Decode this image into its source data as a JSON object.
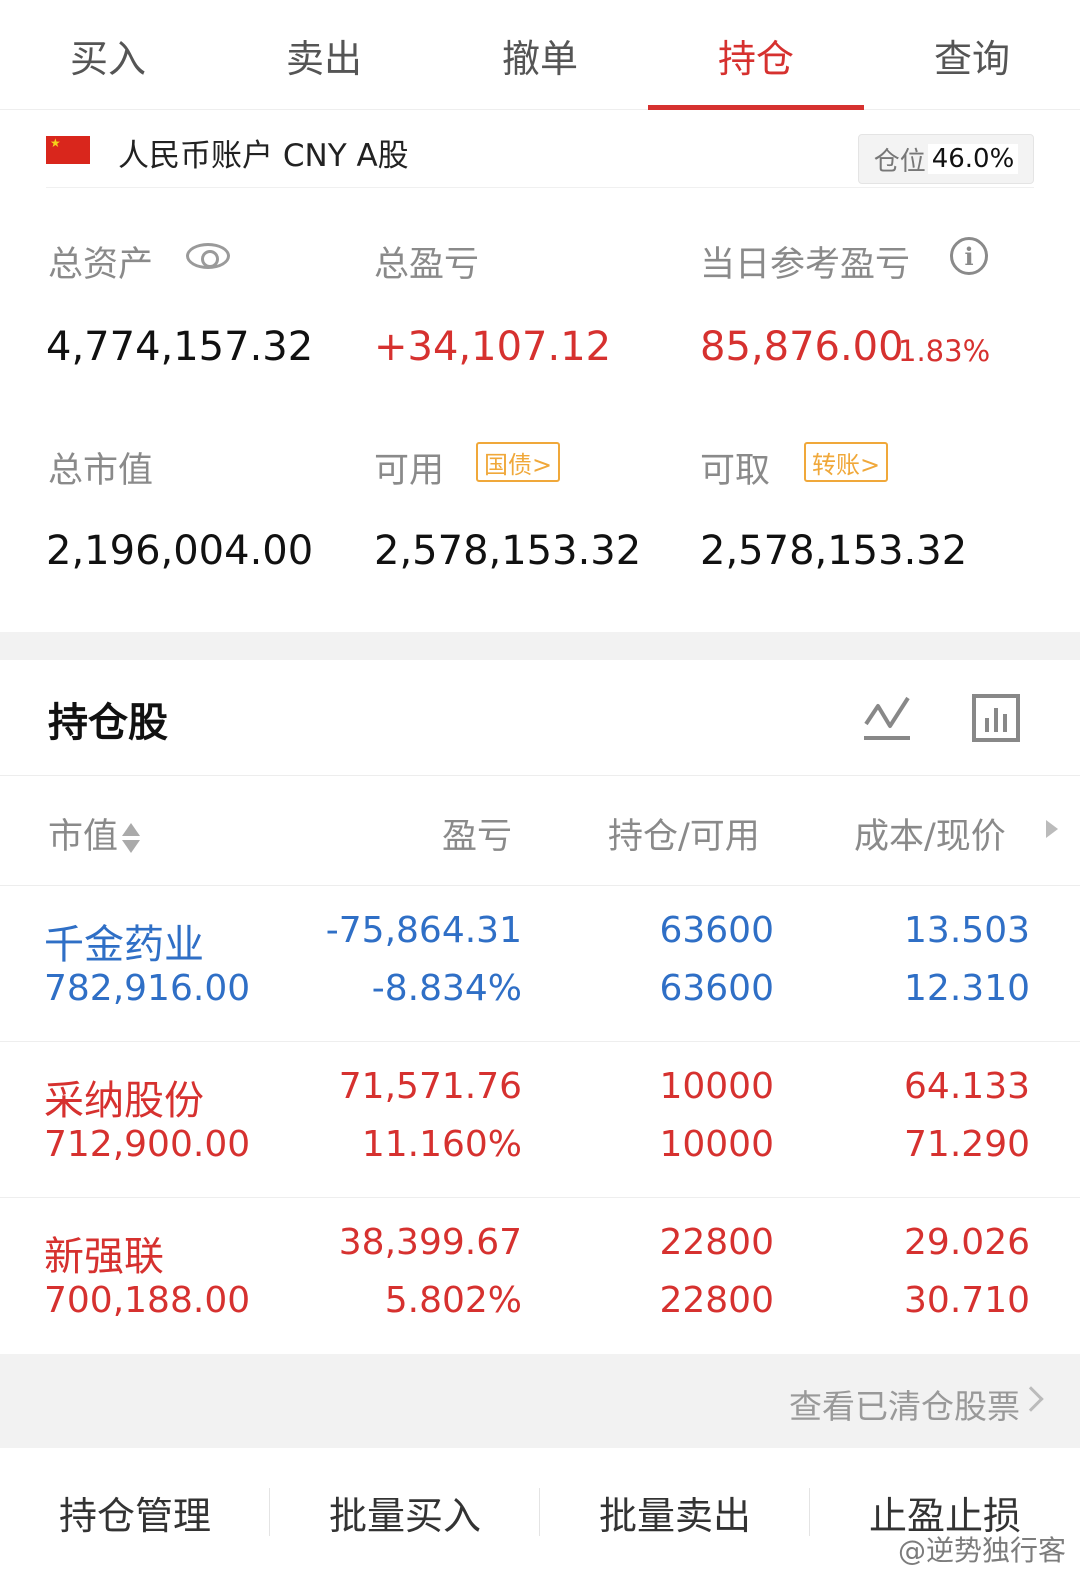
{
  "tabs": [
    {
      "label": "买入"
    },
    {
      "label": "卖出"
    },
    {
      "label": "撤单"
    },
    {
      "label": "持仓"
    },
    {
      "label": "查询"
    }
  ],
  "active_tab": "持仓",
  "account": {
    "name": "人民币账户 CNY A股",
    "position_label": "仓位",
    "position_value": "46.0%"
  },
  "summary": {
    "total_assets_label": "总资产",
    "total_assets": "4,774,157.32",
    "total_pnl_label": "总盈亏",
    "total_pnl": "+34,107.12",
    "daily_pnl_label": "当日参考盈亏",
    "daily_pnl": "85,876.00",
    "daily_pnl_pct": "1.83%",
    "market_value_label": "总市值",
    "market_value": "2,196,004.00",
    "available_label": "可用",
    "available_tag": "国债>",
    "available": "2,578,153.32",
    "withdrawable_label": "可取",
    "withdrawable_tag": "转账>",
    "withdrawable": "2,578,153.32"
  },
  "holdings": {
    "title": "持仓股",
    "columns": [
      "市值",
      "盈亏",
      "持仓/可用",
      "成本/现价"
    ],
    "rows": [
      {
        "name": "千金药业",
        "market_value": "782,916.00",
        "pnl": "-75,864.31",
        "pnl_pct": "-8.834%",
        "position": "63600",
        "available": "63600",
        "cost": "13.503",
        "price": "12.310",
        "color": "#2f6fc6"
      },
      {
        "name": "采纳股份",
        "market_value": "712,900.00",
        "pnl": "71,571.76",
        "pnl_pct": "11.160%",
        "position": "10000",
        "available": "10000",
        "cost": "64.133",
        "price": "71.290",
        "color": "#d6312f"
      },
      {
        "name": "新强联",
        "market_value": "700,188.00",
        "pnl": "38,399.67",
        "pnl_pct": "5.802%",
        "position": "22800",
        "available": "22800",
        "cost": "29.026",
        "price": "30.710",
        "color": "#d6312f"
      }
    ],
    "cleared_link": "查看已清仓股票"
  },
  "actions": [
    {
      "label": "持仓管理"
    },
    {
      "label": "批量买入"
    },
    {
      "label": "批量卖出"
    },
    {
      "label": "止盈止损"
    }
  ],
  "watermark": "@逆势独行客",
  "colors": {
    "accent": "#d6312f",
    "loss": "#2f6fc6",
    "tag": "#f0a83a"
  }
}
